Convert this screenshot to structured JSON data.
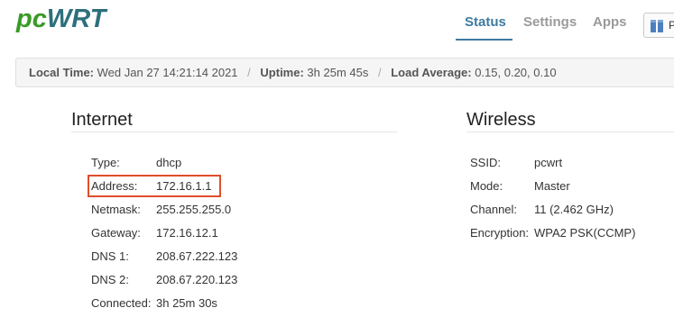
{
  "brand": {
    "part1": "pc",
    "part2": "WRT"
  },
  "nav": {
    "tabs": [
      {
        "label": "Status",
        "active": true
      },
      {
        "label": "Settings",
        "active": false
      },
      {
        "label": "Apps",
        "active": false
      }
    ],
    "language_label": "P"
  },
  "status_bar": {
    "local_time_label": "Local Time:",
    "local_time_value": "Wed Jan 27 14:21:14 2021",
    "uptime_label": "Uptime:",
    "uptime_value": "3h 25m 45s",
    "load_label": "Load Average:",
    "load_value": "0.15, 0.20, 0.10",
    "separator": "/"
  },
  "internet": {
    "title": "Internet",
    "rows": [
      {
        "label": "Type:",
        "value": "dhcp"
      },
      {
        "label": "Address:",
        "value": "172.16.1.1"
      },
      {
        "label": "Netmask:",
        "value": "255.255.255.0"
      },
      {
        "label": "Gateway:",
        "value": "172.16.12.1"
      },
      {
        "label": "DNS 1:",
        "value": "208.67.222.123"
      },
      {
        "label": "DNS 2:",
        "value": "208.67.220.123"
      },
      {
        "label": "Connected:",
        "value": "3h 25m 30s"
      }
    ]
  },
  "wireless": {
    "title": "Wireless",
    "rows": [
      {
        "label": "SSID:",
        "value": "pcwrt"
      },
      {
        "label": "Mode:",
        "value": "Master"
      },
      {
        "label": "Channel:",
        "value": "11 (2.462 GHz)"
      },
      {
        "label": "Encryption:",
        "value": "WPA2 PSK(CCMP)"
      }
    ]
  },
  "colors": {
    "brand_green": "#3a9a26",
    "brand_teal": "#2e6f7c",
    "nav_active": "#3e7aa0",
    "highlight": "#e04e2a"
  }
}
